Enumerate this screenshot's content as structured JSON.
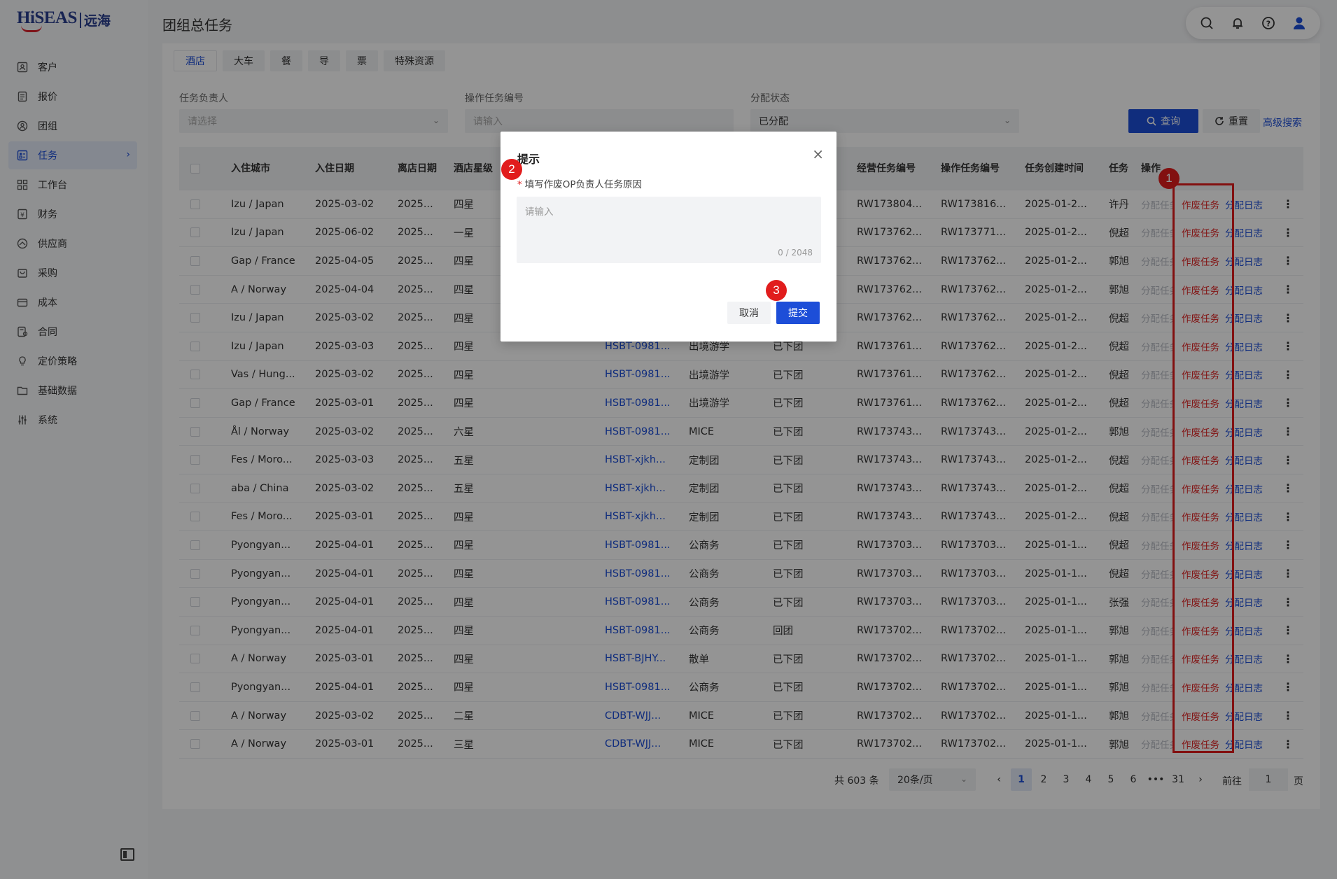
{
  "app": {
    "logo_text": "HiSEAS",
    "logo_cn": "远海",
    "page_title": "团组总任务"
  },
  "sidebar": {
    "items": [
      {
        "label": "客户",
        "icon": "customer-icon"
      },
      {
        "label": "报价",
        "icon": "quote-icon"
      },
      {
        "label": "团组",
        "icon": "group-icon"
      },
      {
        "label": "任务",
        "icon": "task-icon",
        "active": true
      },
      {
        "label": "工作台",
        "icon": "workbench-icon"
      },
      {
        "label": "财务",
        "icon": "finance-icon"
      },
      {
        "label": "供应商",
        "icon": "supplier-icon"
      },
      {
        "label": "采购",
        "icon": "purchase-icon"
      },
      {
        "label": "成本",
        "icon": "cost-icon"
      },
      {
        "label": "合同",
        "icon": "contract-icon"
      },
      {
        "label": "定价策略",
        "icon": "pricing-icon"
      },
      {
        "label": "基础数据",
        "icon": "basedata-icon"
      },
      {
        "label": "系统",
        "icon": "system-icon"
      }
    ]
  },
  "tabs": [
    "酒店",
    "大车",
    "餐",
    "导",
    "票",
    "特殊资源"
  ],
  "filters": {
    "owner_label": "任务负责人",
    "owner_placeholder": "请选择",
    "task_no_label": "操作任务编号",
    "task_no_placeholder": "请输入",
    "status_label": "分配状态",
    "status_value": "已分配",
    "query_button": "查询",
    "reset_button": "重置",
    "advanced_search": "高级搜索"
  },
  "table": {
    "headers": [
      "入住城市",
      "入住日期",
      "离店日期",
      "酒店星级",
      "经营任务编号",
      "操作任务编号",
      "任务创建时间",
      "任务",
      "操作"
    ],
    "action_labels": {
      "assign": "分配任务",
      "void": "作废任务",
      "log": "分配日志"
    },
    "rows": [
      {
        "city": "Izu / Japan",
        "in": "2025-03-02",
        "out": "2025...",
        "star": "四星",
        "group": "",
        "type": "",
        "status": "",
        "biz": "RW173804...",
        "op": "RW173816...",
        "created": "2025-01-2...",
        "owner": "许丹"
      },
      {
        "city": "Izu / Japan",
        "in": "2025-06-02",
        "out": "2025...",
        "star": "一星",
        "group": "",
        "type": "",
        "status": "",
        "biz": "RW173762...",
        "op": "RW173771...",
        "created": "2025-01-2...",
        "owner": "倪超"
      },
      {
        "city": "Gap / France",
        "in": "2025-04-05",
        "out": "2025...",
        "star": "四星",
        "group": "",
        "type": "",
        "status": "",
        "biz": "RW173762...",
        "op": "RW173762...",
        "created": "2025-01-2...",
        "owner": "郭旭"
      },
      {
        "city": "A / Norway",
        "in": "2025-04-04",
        "out": "2025...",
        "star": "四星",
        "group": "",
        "type": "",
        "status": "",
        "biz": "RW173762...",
        "op": "RW173762...",
        "created": "2025-01-2...",
        "owner": "郭旭"
      },
      {
        "city": "Izu / Japan",
        "in": "2025-03-02",
        "out": "2025...",
        "star": "四星",
        "group": "",
        "type": "",
        "status": "",
        "biz": "RW173762...",
        "op": "RW173762...",
        "created": "2025-01-2...",
        "owner": "倪超"
      },
      {
        "city": "Izu / Japan",
        "in": "2025-03-03",
        "out": "2025...",
        "star": "四星",
        "group": "HSBT-0981...",
        "type": "出境游学",
        "status": "已下团",
        "biz": "RW173761...",
        "op": "RW173762...",
        "created": "2025-01-2...",
        "owner": "倪超"
      },
      {
        "city": "Vas / Hung...",
        "in": "2025-03-02",
        "out": "2025...",
        "star": "四星",
        "group": "HSBT-0981...",
        "type": "出境游学",
        "status": "已下团",
        "biz": "RW173761...",
        "op": "RW173762...",
        "created": "2025-01-2...",
        "owner": "倪超"
      },
      {
        "city": "Gap / France",
        "in": "2025-03-01",
        "out": "2025...",
        "star": "四星",
        "group": "HSBT-0981...",
        "type": "出境游学",
        "status": "已下团",
        "biz": "RW173761...",
        "op": "RW173762...",
        "created": "2025-01-2...",
        "owner": "倪超"
      },
      {
        "city": "Ål / Norway",
        "in": "2025-03-02",
        "out": "2025...",
        "star": "六星",
        "group": "HSBT-0981...",
        "type": "MICE",
        "status": "已下团",
        "biz": "RW173743...",
        "op": "RW173743...",
        "created": "2025-01-2...",
        "owner": "郭旭"
      },
      {
        "city": "Fes / Moro...",
        "in": "2025-03-03",
        "out": "2025...",
        "star": "五星",
        "group": "HSBT-xjkh...",
        "type": "定制团",
        "status": "已下团",
        "biz": "RW173743...",
        "op": "RW173743...",
        "created": "2025-01-2...",
        "owner": "倪超"
      },
      {
        "city": "aba / China",
        "in": "2025-03-02",
        "out": "2025...",
        "star": "五星",
        "group": "HSBT-xjkh...",
        "type": "定制团",
        "status": "已下团",
        "biz": "RW173743...",
        "op": "RW173743...",
        "created": "2025-01-2...",
        "owner": "倪超"
      },
      {
        "city": "Fes / Moro...",
        "in": "2025-03-01",
        "out": "2025...",
        "star": "四星",
        "group": "HSBT-xjkh...",
        "type": "定制团",
        "status": "已下团",
        "biz": "RW173743...",
        "op": "RW173743...",
        "created": "2025-01-2...",
        "owner": "倪超"
      },
      {
        "city": "Pyongyan...",
        "in": "2025-04-01",
        "out": "2025...",
        "star": "四星",
        "group": "HSBT-0981...",
        "type": "公商务",
        "status": "已下团",
        "biz": "RW173703...",
        "op": "RW173703...",
        "created": "2025-01-1...",
        "owner": "倪超"
      },
      {
        "city": "Pyongyan...",
        "in": "2025-04-01",
        "out": "2025...",
        "star": "四星",
        "group": "HSBT-0981...",
        "type": "公商务",
        "status": "已下团",
        "biz": "RW173703...",
        "op": "RW173703...",
        "created": "2025-01-1...",
        "owner": "倪超"
      },
      {
        "city": "Pyongyan...",
        "in": "2025-04-01",
        "out": "2025...",
        "star": "四星",
        "group": "HSBT-0981...",
        "type": "公商务",
        "status": "已下团",
        "biz": "RW173703...",
        "op": "RW173703...",
        "created": "2025-01-1...",
        "owner": "张强"
      },
      {
        "city": "Pyongyan...",
        "in": "2025-04-01",
        "out": "2025...",
        "star": "四星",
        "group": "HSBT-0981...",
        "type": "公商务",
        "status": "回团",
        "biz": "RW173702...",
        "op": "RW173702...",
        "created": "2025-01-1...",
        "owner": "郭旭"
      },
      {
        "city": "A / Norway",
        "in": "2025-03-01",
        "out": "2025...",
        "star": "四星",
        "group": "HSBT-BJHY...",
        "type": "散单",
        "status": "已下团",
        "biz": "RW173702...",
        "op": "RW173702...",
        "created": "2025-01-1...",
        "owner": "郭旭"
      },
      {
        "city": "Pyongyan...",
        "in": "2025-04-01",
        "out": "2025...",
        "star": "四星",
        "group": "HSBT-0981...",
        "type": "公商务",
        "status": "已下团",
        "biz": "RW173702...",
        "op": "RW173702...",
        "created": "2025-01-1...",
        "owner": "郭旭"
      },
      {
        "city": "A / Norway",
        "in": "2025-03-02",
        "out": "2025...",
        "star": "二星",
        "group": "CDBT-WJJ...",
        "type": "MICE",
        "status": "已下团",
        "biz": "RW173702...",
        "op": "RW173702...",
        "created": "2025-01-1...",
        "owner": "郭旭"
      },
      {
        "city": "A / Norway",
        "in": "2025-03-01",
        "out": "2025...",
        "star": "三星",
        "group": "CDBT-WJJ...",
        "type": "MICE",
        "status": "已下团",
        "biz": "RW173702...",
        "op": "RW173702...",
        "created": "2025-01-1...",
        "owner": "郭旭"
      }
    ]
  },
  "pagination": {
    "total": "共 603 条",
    "page_size": "20条/页",
    "pages": [
      "1",
      "2",
      "3",
      "4",
      "5",
      "6",
      "•••",
      "31"
    ],
    "goto_prefix": "前往",
    "goto_value": "1",
    "goto_suffix": "页"
  },
  "dialog": {
    "title": "提示",
    "field_label": "填写作废OP负责人任务原因",
    "placeholder": "请输入",
    "counter": "0 / 2048",
    "cancel": "取消",
    "submit": "提交"
  },
  "annotations": [
    "1",
    "2",
    "3"
  ],
  "colors": {
    "primary": "#1d4ed8",
    "danger": "#e02424",
    "highlight": "#e11d1d"
  }
}
